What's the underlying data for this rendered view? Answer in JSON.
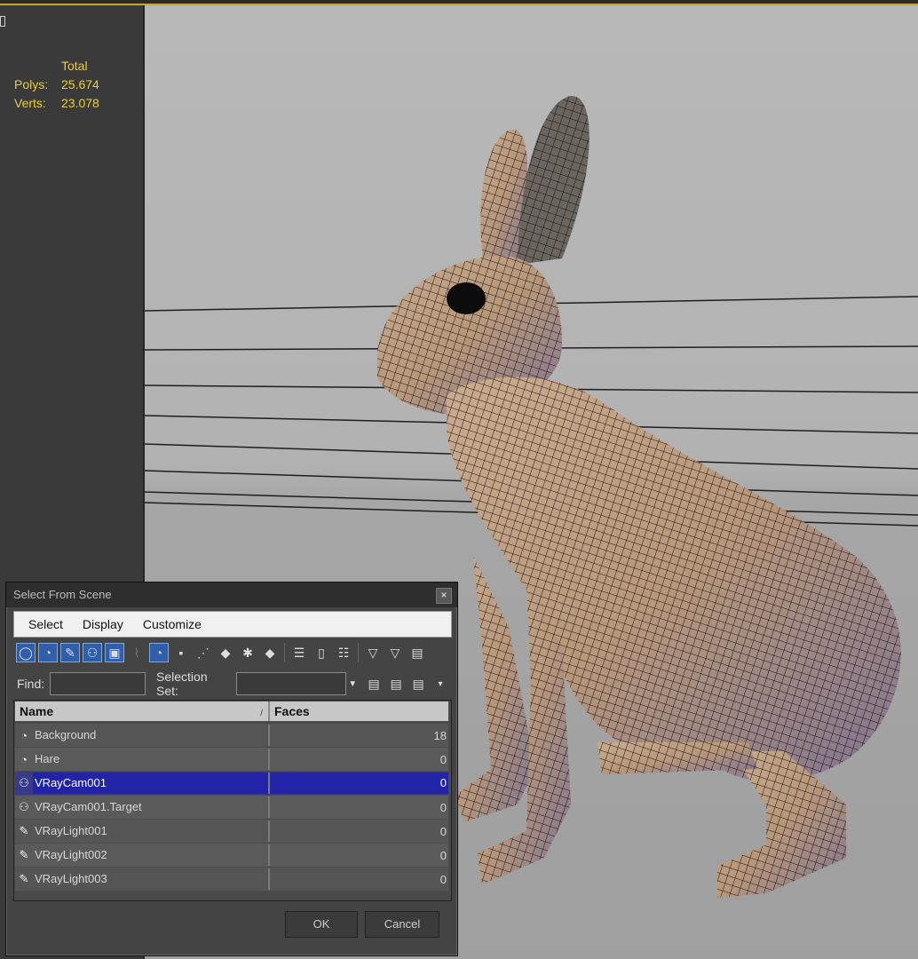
{
  "stats": {
    "header": "Total",
    "rows": [
      {
        "label": "Polys:",
        "value": "25.674"
      },
      {
        "label": "Verts:",
        "value": "23.078"
      }
    ]
  },
  "dialog": {
    "title": "Select From Scene",
    "menu": [
      "Select",
      "Display",
      "Customize"
    ],
    "find_label": "Find:",
    "find_value": "",
    "selection_set_label": "Selection Set:",
    "selection_set_value": "",
    "columns": {
      "name": "Name",
      "faces": "Faces"
    },
    "rows": [
      {
        "name": "Background",
        "faces": "18",
        "icon": "geometry-icon"
      },
      {
        "name": "Hare",
        "faces": "0",
        "icon": "geometry-icon"
      },
      {
        "name": "VRayCam001",
        "faces": "0",
        "icon": "camera-icon",
        "selected": true
      },
      {
        "name": "VRayCam001.Target",
        "faces": "0",
        "icon": "camera-icon"
      },
      {
        "name": "VRayLight001",
        "faces": "0",
        "icon": "light-icon"
      },
      {
        "name": "VRayLight002",
        "faces": "0",
        "icon": "light-icon"
      },
      {
        "name": "VRayLight003",
        "faces": "0",
        "icon": "light-icon"
      }
    ],
    "ok_label": "OK",
    "cancel_label": "Cancel"
  },
  "colors": {
    "stats_text": "#e8cf3a",
    "selection": "#2323a8",
    "viewport_bg": "#b4b4b4"
  }
}
